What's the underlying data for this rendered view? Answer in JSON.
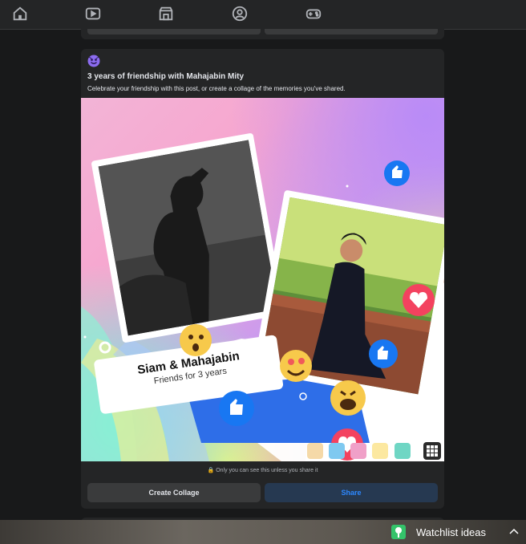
{
  "nav": {
    "icons": [
      "home-icon",
      "video-icon",
      "marketplace-icon",
      "groups-icon",
      "gaming-icon"
    ]
  },
  "memory_card": {
    "title": "3 years of friendship with Mahajabin Mity",
    "subtitle": "Celebrate your friendship with this post, or create a collage of the memories you've shared.",
    "art": {
      "names": "Siam & Mahajabin",
      "caption": "Friends for 3 years"
    },
    "privacy_notice": "Only you can see this unless you share it",
    "collage_button": "Create Collage",
    "share_button": "Share"
  },
  "taskbar": {
    "widget_label": "Watchlist ideas"
  },
  "colors": {
    "page_bg": "#18191a",
    "card_bg": "#242526",
    "button_bg": "#3a3b3c",
    "share_bg": "#263951",
    "accent_blue": "#2d88ff"
  }
}
